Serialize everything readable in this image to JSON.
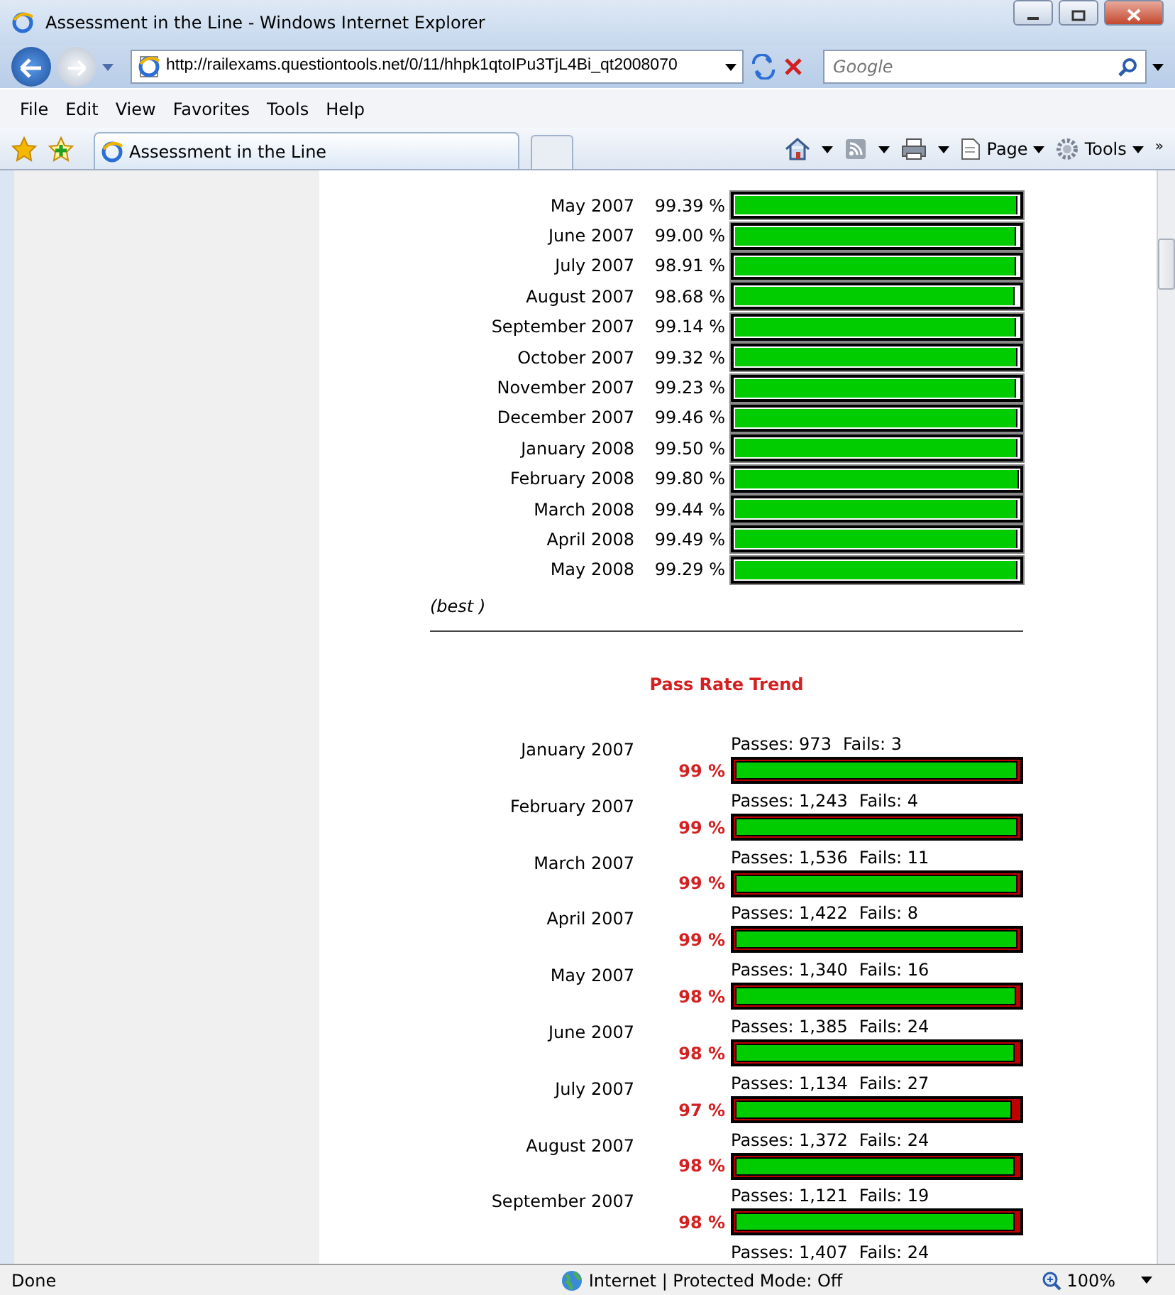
{
  "window": {
    "title": "Assessment in the Line - Windows Internet Explorer"
  },
  "address_bar": {
    "url": "http://railexams.questiontools.net/0/11/hhpk1qtoIPu3TjL4Bi_qt2008070"
  },
  "search": {
    "placeholder": "Google"
  },
  "menu": [
    "File",
    "Edit",
    "View",
    "Favorites",
    "Tools",
    "Help"
  ],
  "tabs": [
    {
      "label": "Assessment in the Line",
      "selected": true
    }
  ],
  "toolbar": {
    "page": "Page",
    "tools": "Tools",
    "more": "»"
  },
  "monthly_scores": [
    {
      "month": "May 2007",
      "score": "99.39 %",
      "level": 0.9939
    },
    {
      "month": "June 2007",
      "score": "99.00 %",
      "level": 0.99
    },
    {
      "month": "July 2007",
      "score": "98.91 %",
      "level": 0.9891
    },
    {
      "month": "August 2007",
      "score": "98.68 %",
      "level": 0.9868
    },
    {
      "month": "September 2007",
      "score": "99.14 %",
      "level": 0.9914
    },
    {
      "month": "October 2007",
      "score": "99.32 %",
      "level": 0.9932
    },
    {
      "month": "November 2007",
      "score": "99.23 %",
      "level": 0.9923
    },
    {
      "month": "December 2007",
      "score": "99.46 %",
      "level": 0.9946
    },
    {
      "month": "January 2008",
      "score": "99.50 %",
      "level": 0.995
    },
    {
      "month": "February 2008",
      "score": "99.80 %",
      "level": 0.998
    },
    {
      "month": "March 2008",
      "score": "99.44 %",
      "level": 0.9944
    },
    {
      "month": "April 2008",
      "score": "99.49 %",
      "level": 0.9949
    },
    {
      "month": "May 2008",
      "score": "99.29 %",
      "level": 0.9929
    }
  ],
  "note": "(best )",
  "trend": {
    "title": "Pass Rate Trend",
    "items": [
      {
        "month": "January 2007",
        "rate": "99 %",
        "passes": "Passes: 973",
        "fails": "Fails: 3",
        "level": 0.997
      },
      {
        "month": "February 2007",
        "rate": "99 %",
        "passes": "Passes: 1,243",
        "fails": "Fails: 4",
        "level": 0.997
      },
      {
        "month": "March 2007",
        "rate": "99 %",
        "passes": "Passes: 1,536",
        "fails": "Fails: 11",
        "level": 0.993
      },
      {
        "month": "April 2007",
        "rate": "99 %",
        "passes": "Passes: 1,422",
        "fails": "Fails: 8",
        "level": 0.994
      },
      {
        "month": "May 2007",
        "rate": "98 %",
        "passes": "Passes: 1,340",
        "fails": "Fails: 16",
        "level": 0.988
      },
      {
        "month": "June 2007",
        "rate": "98 %",
        "passes": "Passes: 1,385",
        "fails": "Fails: 24",
        "level": 0.983
      },
      {
        "month": "July 2007",
        "rate": "97 %",
        "passes": "Passes: 1,134",
        "fails": "Fails: 27",
        "level": 0.977
      },
      {
        "month": "August 2007",
        "rate": "98 %",
        "passes": "Passes: 1,372",
        "fails": "Fails: 24",
        "level": 0.983
      },
      {
        "month": "September 2007",
        "rate": "98 %",
        "passes": "Passes: 1,121",
        "fails": "Fails: 19",
        "level": 0.983
      },
      {
        "passes": "Passes: 1,407",
        "fails": "Fails: 24"
      }
    ]
  },
  "status_bar": {
    "text": "Done",
    "zone": "Internet | Protected Mode: Off",
    "zoom": "100%"
  }
}
